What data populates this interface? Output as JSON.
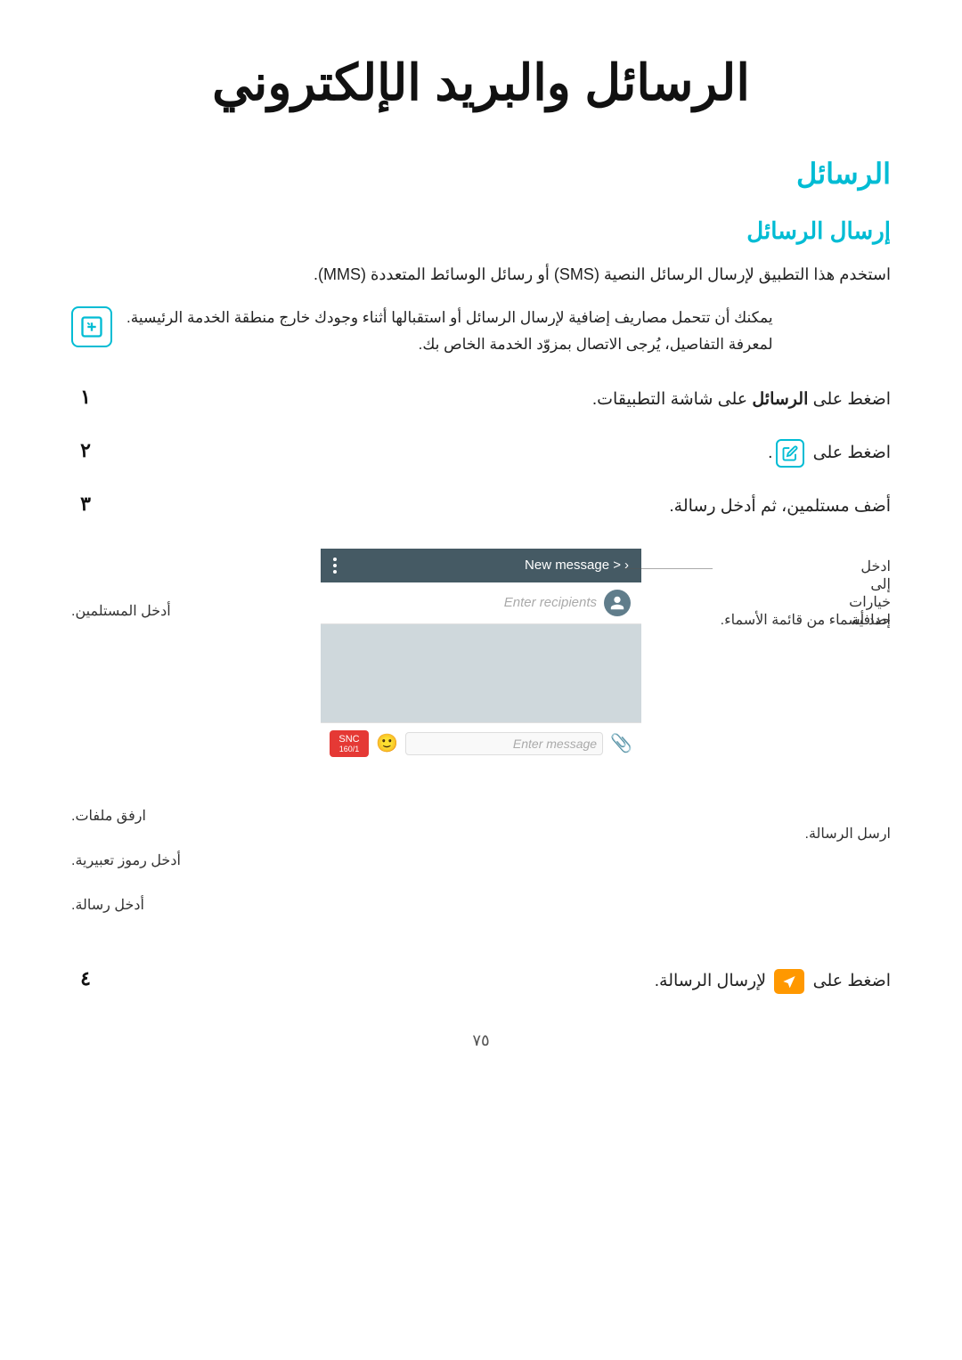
{
  "page": {
    "main_title": "الرسائل والبريد الإلكتروني",
    "section_title": "الرسائل",
    "subsection_title": "إرسال الرسائل",
    "intro_text": "استخدم هذا التطبيق لإرسال الرسائل النصية (SMS) أو رسائل الوسائط المتعددة (MMS).",
    "note_text_1": "يمكنك أن تتحمل مصاريف إضافية لإرسال الرسائل أو استقبالها أثناء وجودك خارج منطقة الخدمة الرئيسية.",
    "note_text_2": "لمعرفة التفاصيل، يُرجى الاتصال بمزوّد الخدمة الخاص بك.",
    "steps": [
      {
        "number": "١",
        "text": "اضغط على ",
        "bold": "الرسائل",
        "text2": " على شاشة التطبيقات."
      },
      {
        "number": "٢",
        "text": "اضغط على ",
        "icon": "edit",
        "text2": "."
      },
      {
        "number": "٣",
        "text": "أضف مستلمين، ثم أدخل رسالة."
      },
      {
        "number": "٤",
        "text": "اضغط على ",
        "icon": "send",
        "text2": " لإرسال الرسالة."
      }
    ],
    "phone_ui": {
      "header_back": "< New message",
      "header_more_dots": "⋮",
      "recipients_placeholder": "Enter recipients",
      "compose_placeholder": "Enter message",
      "send_label": "SNC",
      "send_count": "160/1"
    },
    "annotations": {
      "right": [
        "ادخل إلى خيارات إضافية.",
        "حدد أسماء من قائمة الأسماء.",
        "ارسل الرسالة."
      ],
      "left": [
        "أدخل المستلمين.",
        "ارفق ملفات.",
        "أدخل رموز تعبيرية.",
        "أدخل رسالة."
      ]
    },
    "footer": {
      "page_number": "٧٥"
    }
  }
}
